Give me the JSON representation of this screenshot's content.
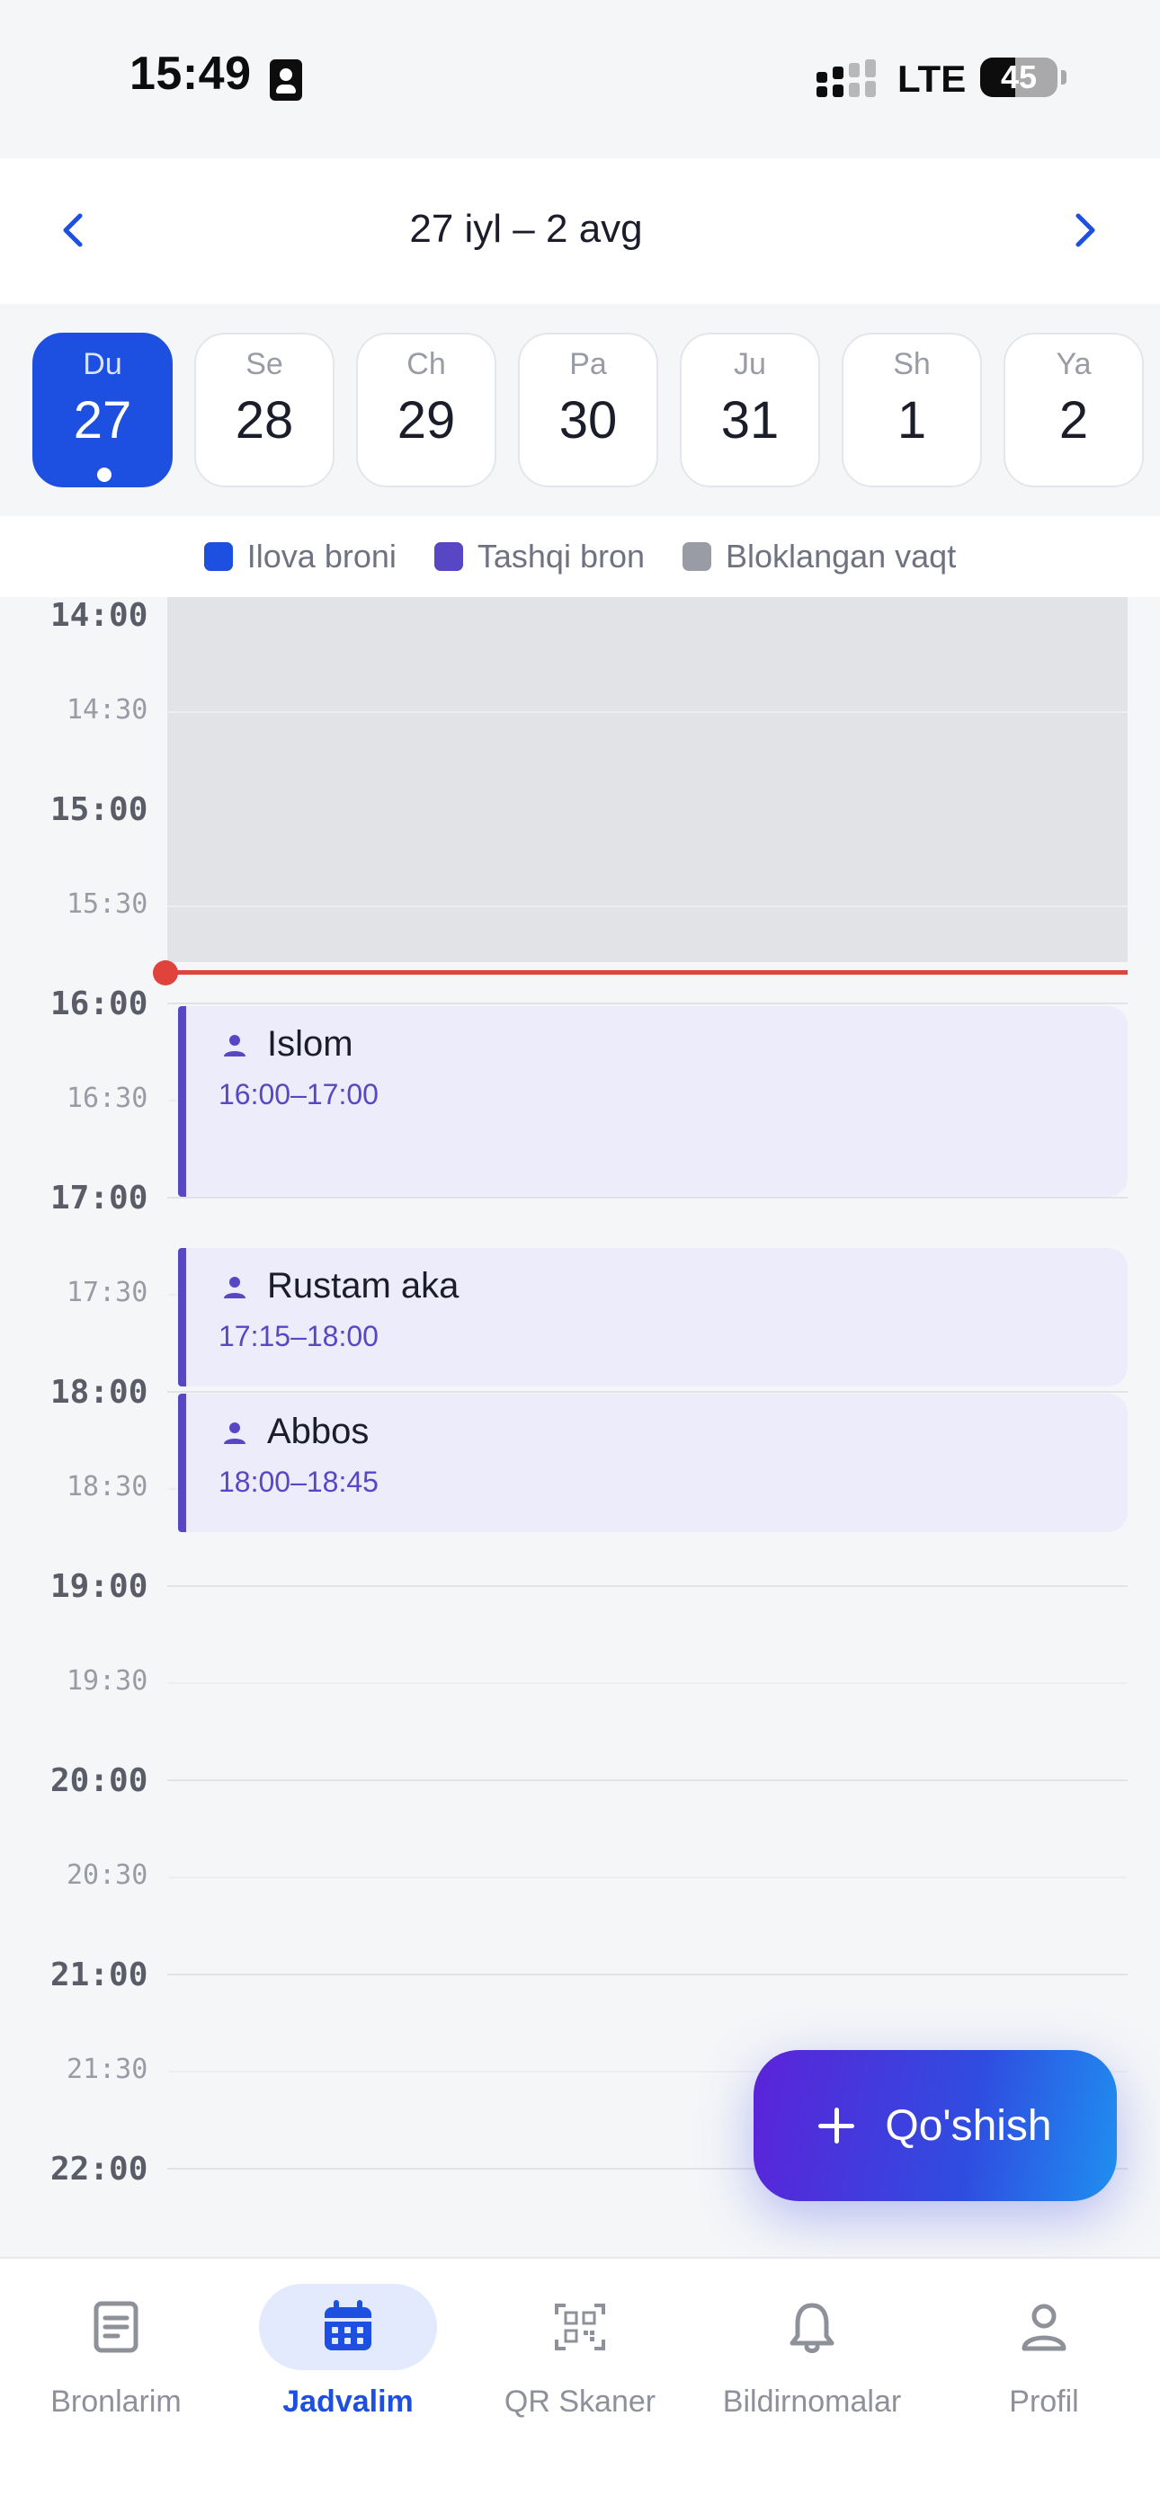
{
  "status_bar": {
    "time": "15:49",
    "network": "LTE",
    "battery": "45",
    "battery_level_percent": 45
  },
  "week": {
    "range": "27 iyl – 2 avg",
    "days": [
      {
        "name": "Du",
        "num": "27",
        "active": true
      },
      {
        "name": "Se",
        "num": "28",
        "active": false
      },
      {
        "name": "Ch",
        "num": "29",
        "active": false
      },
      {
        "name": "Pa",
        "num": "30",
        "active": false
      },
      {
        "name": "Ju",
        "num": "31",
        "active": false
      },
      {
        "name": "Sh",
        "num": "1",
        "active": false
      },
      {
        "name": "Ya",
        "num": "2",
        "active": false
      }
    ]
  },
  "legend": [
    {
      "label": "Ilova broni",
      "color": "#1d4fe0"
    },
    {
      "label": "Tashqi bron",
      "color": "#5747c4"
    },
    {
      "label": "Bloklangan vaqt",
      "color": "#9a9ca5"
    }
  ],
  "timeline": {
    "hours": [
      {
        "label": "14:00",
        "type": "hour"
      },
      {
        "label": "14:30",
        "type": "half"
      },
      {
        "label": "15:00",
        "type": "hour"
      },
      {
        "label": "15:30",
        "type": "half"
      },
      {
        "label": "16:00",
        "type": "hour"
      },
      {
        "label": "16:30",
        "type": "half"
      },
      {
        "label": "17:00",
        "type": "hour"
      },
      {
        "label": "17:30",
        "type": "half"
      },
      {
        "label": "18:00",
        "type": "hour"
      },
      {
        "label": "18:30",
        "type": "half"
      },
      {
        "label": "19:00",
        "type": "hour"
      },
      {
        "label": "19:30",
        "type": "half"
      },
      {
        "label": "20:00",
        "type": "hour"
      },
      {
        "label": "20:30",
        "type": "half"
      },
      {
        "label": "21:00",
        "type": "hour"
      },
      {
        "label": "21:30",
        "type": "half"
      },
      {
        "label": "22:00",
        "type": "hour"
      }
    ],
    "events": [
      {
        "name": "Islom",
        "time": "16:00–17:00"
      },
      {
        "name": "Rustam aka",
        "time": "17:15–18:00"
      },
      {
        "name": "Abbos",
        "time": "18:00–18:45"
      }
    ]
  },
  "fab": {
    "label": "Qo'shish"
  },
  "colors": {
    "accent": "#1d4fe0",
    "external_booking": "#5747c4",
    "now_line": "#e0433b",
    "blocked": "#e2e3e6"
  },
  "nav": [
    {
      "label": "Bronlarim",
      "icon": "document-icon",
      "active": false
    },
    {
      "label": "Jadvalim",
      "icon": "calendar-icon",
      "active": true
    },
    {
      "label": "QR Skaner",
      "icon": "qr-scan-icon",
      "active": false
    },
    {
      "label": "Bildirnomalar",
      "icon": "bell-icon",
      "active": false
    },
    {
      "label": "Profil",
      "icon": "profile-icon",
      "active": false
    }
  ]
}
